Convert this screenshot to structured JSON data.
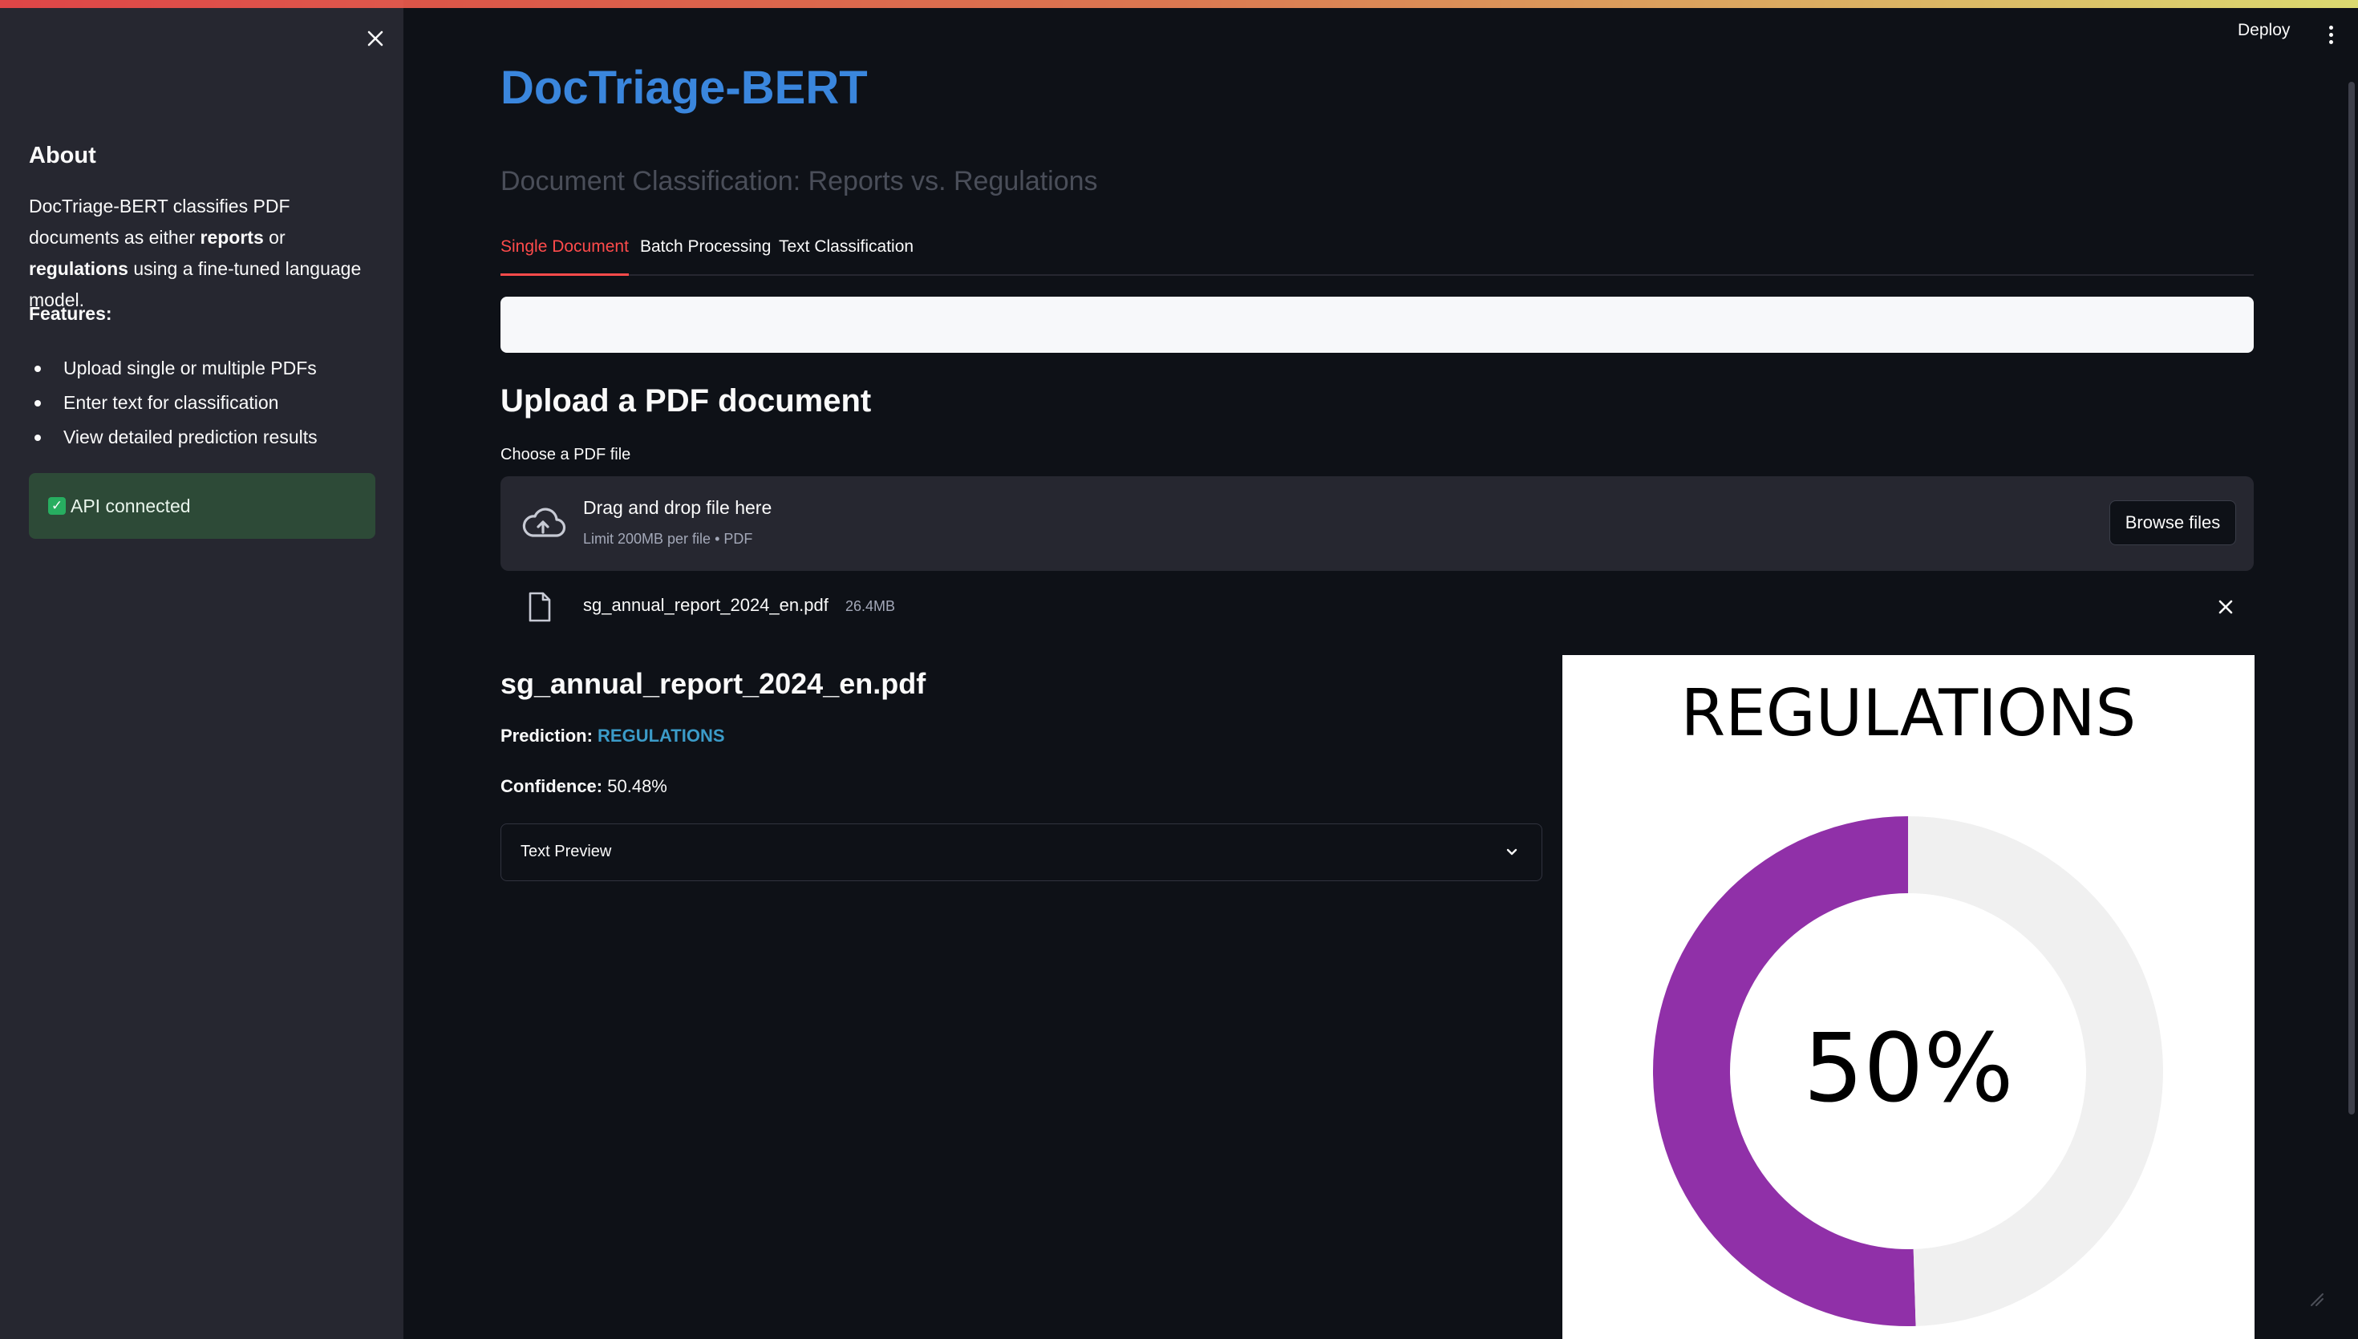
{
  "header": {
    "deploy_label": "Deploy"
  },
  "sidebar": {
    "about_heading": "About",
    "about_text": {
      "part1": "DocTriage-BERT classifies PDF documents as either ",
      "reports": "reports",
      "part2": " or ",
      "regulations": "regulations",
      "part3": " using a fine-tuned language model."
    },
    "features_heading": "Features:",
    "features": [
      "Upload single or multiple PDFs",
      "Enter text for classification",
      "View detailed prediction results"
    ],
    "api_status": "API connected"
  },
  "main": {
    "title": "DocTriage-BERT",
    "subtitle": "Document Classification: Reports vs. Regulations",
    "tabs": [
      {
        "label": "Single Document",
        "active": true
      },
      {
        "label": "Batch Processing",
        "active": false
      },
      {
        "label": "Text Classification",
        "active": false
      }
    ],
    "upload_heading": "Upload a PDF document",
    "uploader": {
      "label": "Choose a PDF file",
      "drop_title": "Drag and drop file here",
      "limit_text": "Limit 200MB per file • PDF",
      "browse_label": "Browse files"
    },
    "uploaded_file": {
      "name": "sg_annual_report_2024_en.pdf",
      "size": "26.4MB"
    },
    "result": {
      "file_name": "sg_annual_report_2024_en.pdf",
      "prediction_label": "Prediction:",
      "prediction_value": "REGULATIONS",
      "confidence_label": "Confidence:",
      "confidence_value": "50.48%",
      "expander_label": "Text Preview"
    }
  },
  "colors": {
    "accent": "#ff4b4b",
    "title_blue": "#3a86dd",
    "prediction_blue": "#3b9bc8",
    "donut_fill": "#9030a8",
    "donut_rest": "#f0f0f0",
    "api_bg": "#2d4a37"
  },
  "chart_data": {
    "type": "pie",
    "title": "REGULATIONS",
    "center_label": "50%",
    "values": [
      50.48,
      49.52
    ],
    "colors": [
      "#9030a8",
      "#f0f0f0"
    ]
  }
}
